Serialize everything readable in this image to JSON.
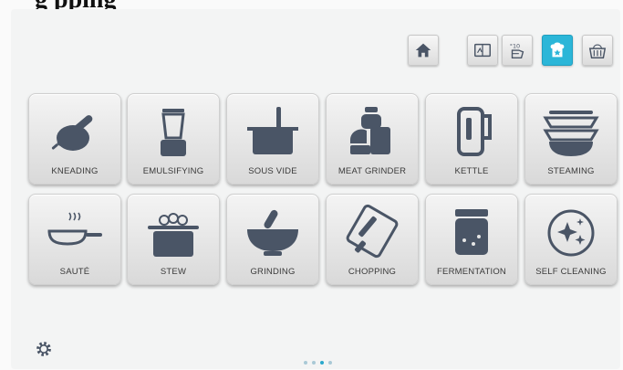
{
  "clip_title": "g   pping",
  "top_buttons": [
    {
      "name": "home",
      "icon": "home-icon",
      "active": false
    },
    {
      "name": "recipes",
      "icon": "recipe-book-icon",
      "active": false
    },
    {
      "name": "manual",
      "icon": "manual-cooking-icon",
      "active": false
    },
    {
      "name": "chef-functions",
      "icon": "chef-hat-star-icon",
      "active": true
    },
    {
      "name": "basket",
      "icon": "basket-icon",
      "active": false
    }
  ],
  "tiles": [
    {
      "label": "KNEADING",
      "icon": "kneading-icon"
    },
    {
      "label": "EMULSIFYING",
      "icon": "blender-icon"
    },
    {
      "label": "SOUS VIDE",
      "icon": "sous-vide-icon"
    },
    {
      "label": "MEAT GRINDER",
      "icon": "meat-grinder-icon"
    },
    {
      "label": "KETTLE",
      "icon": "kettle-icon"
    },
    {
      "label": "STEAMING",
      "icon": "steamer-icon"
    },
    {
      "label": "SAUTÉ",
      "icon": "frying-pan-icon"
    },
    {
      "label": "STEW",
      "icon": "stew-pot-icon"
    },
    {
      "label": "GRINDING",
      "icon": "mortar-pestle-icon"
    },
    {
      "label": "CHOPPING",
      "icon": "cutting-board-icon"
    },
    {
      "label": "FERMENTATION",
      "icon": "jar-icon"
    },
    {
      "label": "SELF CLEANING",
      "icon": "sparkle-clean-icon"
    }
  ],
  "settings_icon": "gear-icon",
  "pagination": {
    "pages": 4,
    "current": 3
  },
  "colors": {
    "accent": "#2bb6d8",
    "icon": "#4a5566",
    "background": "#f3f4f4"
  }
}
